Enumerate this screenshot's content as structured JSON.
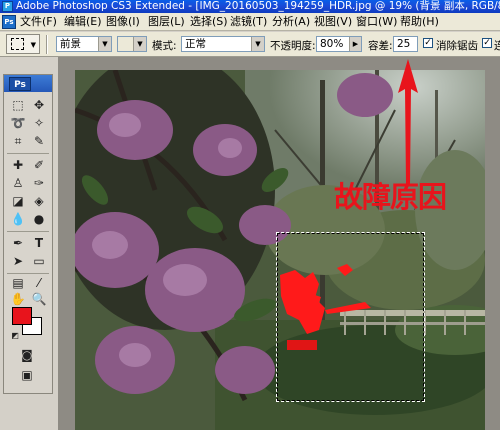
{
  "window": {
    "title": "Adobe Photoshop CS3 Extended - [IMG_20160503_194259_HDR.jpg @ 19% (背景 副本, RGB/8)]"
  },
  "menu": {
    "items": [
      "文件(F)",
      "编辑(E)",
      "图像(I)",
      "图层(L)",
      "选择(S)",
      "滤镜(T)",
      "分析(A)",
      "视图(V)",
      "窗口(W)",
      "帮助(H)"
    ]
  },
  "options_bar": {
    "sample_select": "前景",
    "mode_label": "模式:",
    "mode_value": "正常",
    "opacity_label": "不透明度:",
    "opacity_value": "80%",
    "tolerance_label": "容差:",
    "tolerance_value": "25",
    "antialias_label": "消除锯齿",
    "contiguous_label": "连"
  },
  "tools": {
    "logo": "Ps"
  },
  "annotation": {
    "text": "故障原因",
    "color": "#e8141c"
  },
  "colors": {
    "foreground": "#e8141c",
    "background": "#ffffff",
    "title_bar": "#1b49d6"
  }
}
